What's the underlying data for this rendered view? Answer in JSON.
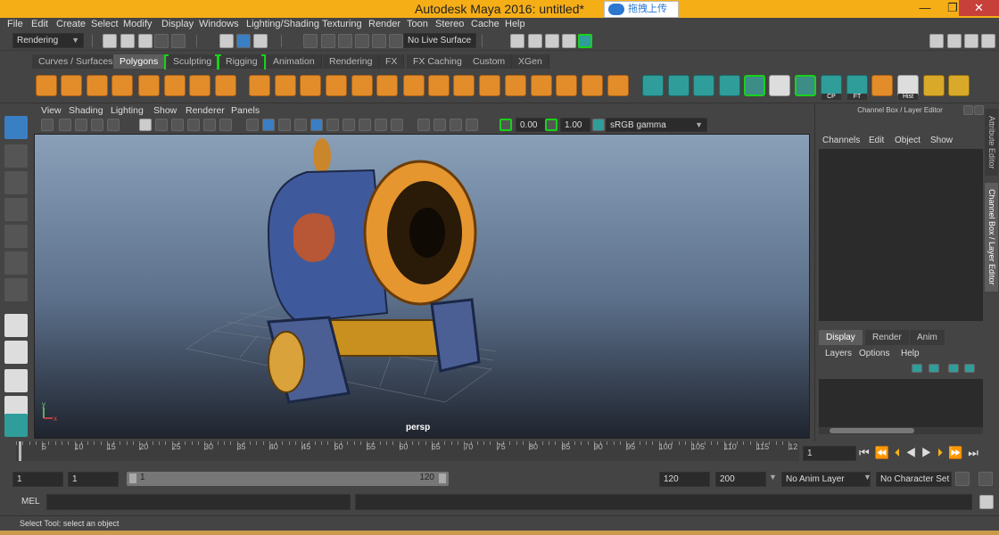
{
  "window": {
    "title": "Autodesk Maya 2016: untitled*",
    "upload_button": "拖拽上传",
    "minimize": "—",
    "restore": "❐",
    "close": "✕"
  },
  "menubar": [
    "File",
    "Edit",
    "Create",
    "Select",
    "Modify",
    "Display",
    "Windows",
    "Lighting/Shading",
    "Texturing",
    "Render",
    "Toon",
    "Stereo",
    "Cache",
    "Help"
  ],
  "toolbar": {
    "menuset": "Rendering",
    "live_surface": "No Live Surface"
  },
  "shelf_tabs": [
    {
      "label": "Curves / Surfaces",
      "active": false,
      "green": false
    },
    {
      "label": "Polygons",
      "active": true,
      "green": false
    },
    {
      "label": "Sculpting",
      "active": false,
      "green": true
    },
    {
      "label": "Rigging",
      "active": false,
      "green": true
    },
    {
      "label": "Animation",
      "active": false,
      "green": false
    },
    {
      "label": "Rendering",
      "active": false,
      "green": false
    },
    {
      "label": "FX",
      "active": false,
      "green": false
    },
    {
      "label": "FX Caching",
      "active": false,
      "green": false
    },
    {
      "label": "Custom",
      "active": false,
      "green": false
    },
    {
      "label": "XGen",
      "active": false,
      "green": false
    }
  ],
  "shelf_icon_labels": {
    "cp": "CP",
    "ft": "FT",
    "hist": "Hist"
  },
  "viewport": {
    "menu": [
      "View",
      "Shading",
      "Lighting",
      "Show",
      "Renderer",
      "Panels"
    ],
    "exposure": "0.00",
    "gamma": "1.00",
    "color_space": "sRGB gamma",
    "camera": "persp",
    "axis_y": "y",
    "axis_x": "x"
  },
  "channel_box": {
    "header": "Channel Box / Layer Editor",
    "menu": [
      "Channels",
      "Edit",
      "Object",
      "Show"
    ]
  },
  "layer_editor": {
    "tabs": [
      "Display",
      "Render",
      "Anim"
    ],
    "menu": [
      "Layers",
      "Options",
      "Help"
    ]
  },
  "side_tabs": [
    "Attribute Editor",
    "Channel Box / Layer Editor"
  ],
  "timeline": {
    "ticks": [
      "5",
      "10",
      "15",
      "20",
      "25",
      "30",
      "35",
      "40",
      "45",
      "50",
      "55",
      "60",
      "65",
      "70",
      "75",
      "80",
      "85",
      "90",
      "95",
      "100",
      "105",
      "110",
      "115",
      "12"
    ],
    "current_frame": "1"
  },
  "range": {
    "start": "1",
    "start_inner": "1",
    "slider_start": "1",
    "slider_end": "120",
    "end_inner": "120",
    "end": "200",
    "anim_layer": "No Anim Layer",
    "character_set": "No Character Set"
  },
  "command_line": {
    "label": "MEL"
  },
  "help_line": "Select Tool: select an object"
}
